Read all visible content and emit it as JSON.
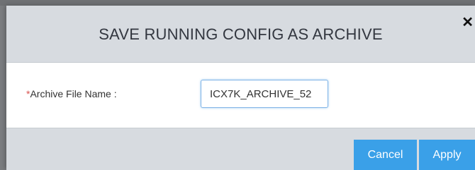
{
  "dialog": {
    "title": "SAVE RUNNING CONFIG AS ARCHIVE",
    "close_icon": "close-icon",
    "close_glyph": "✕"
  },
  "form": {
    "required_marker": "*",
    "archive_label": "Archive File Name :",
    "archive_value": "ICX7K_ARCHIVE_52"
  },
  "footer": {
    "cancel_label": "Cancel",
    "apply_label": "Apply"
  },
  "colors": {
    "button_bg": "#3aa0e8",
    "header_bg": "#d7dbe0",
    "required": "#d9534f"
  }
}
